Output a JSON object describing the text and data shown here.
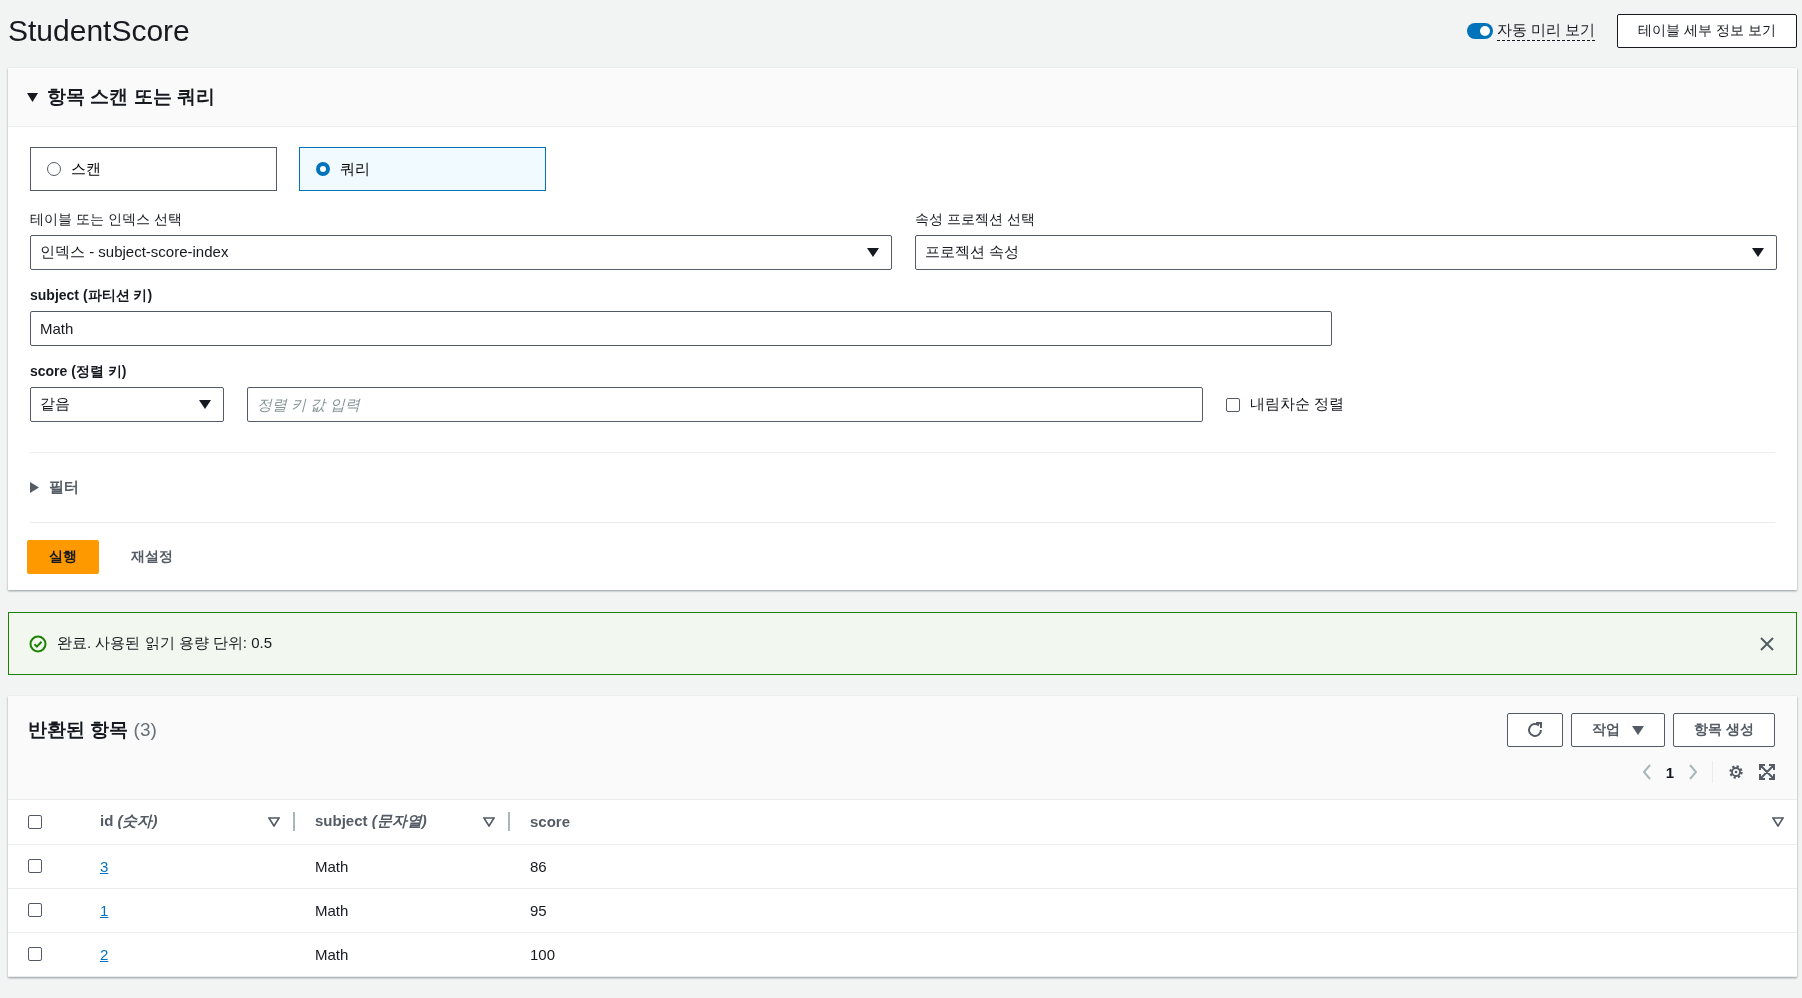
{
  "page": {
    "title": "StudentScore"
  },
  "header_actions": {
    "auto_preview": {
      "label": "자동 미리 보기",
      "on": true
    },
    "details_button": "테이블 세부 정보 보기"
  },
  "query_panel": {
    "title": "항목 스캔 또는 쿼리",
    "expanded": true,
    "modes": [
      {
        "label": "스캔",
        "selected": false
      },
      {
        "label": "쿼리",
        "selected": true
      }
    ],
    "table_select": {
      "label": "테이블 또는 인덱스 선택",
      "value": "인덱스 - subject-score-index"
    },
    "projection_select": {
      "label": "속성 프로젝션 선택",
      "value": "프로젝션 속성"
    },
    "partition_key": {
      "label": "subject (파티션 키)",
      "value": "Math"
    },
    "sort_key": {
      "label": "score (정렬 키)",
      "operator": "같음",
      "placeholder": "정렬 키 값 입력",
      "descending": {
        "label": "내림차순 정렬",
        "checked": false
      }
    },
    "filter": {
      "label": "필터",
      "expanded": false
    },
    "run_button": "실행",
    "reset_button": "재설정"
  },
  "alert": {
    "text": "완료. 사용된 읽기 용량 단위: 0.5"
  },
  "results": {
    "title": "반환된 항목",
    "count": "(3)",
    "actions_button": "작업",
    "create_button": "항목 생성",
    "page": "1",
    "all_checked": false,
    "columns": [
      {
        "label": "id *(숫자)*"
      },
      {
        "label": "subject *(문자열)*"
      },
      {
        "label": "score"
      }
    ],
    "rows": [
      {
        "id": "3",
        "subject": "Math",
        "score": "86",
        "selected": false
      },
      {
        "id": "1",
        "subject": "Math",
        "score": "95",
        "selected": false
      },
      {
        "id": "2",
        "subject": "Math",
        "score": "100",
        "selected": false
      }
    ]
  }
}
